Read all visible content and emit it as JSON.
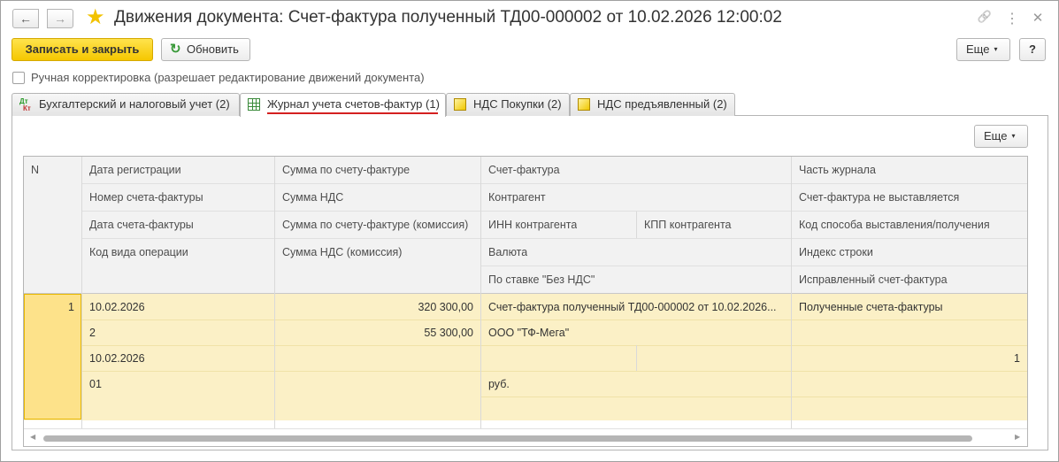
{
  "window": {
    "title": "Движения документа: Счет-фактура полученный ТД00-000002 от 10.02.2026 12:00:02"
  },
  "icons": {
    "back": "←",
    "forward": "→",
    "star": "★",
    "link": "🔗",
    "more": "⋮",
    "close": "✕",
    "refresh": "↻",
    "caret": "▾",
    "sb_left": "◀",
    "sb_right": "▶"
  },
  "toolbar": {
    "save_close_label": "Записать и закрыть",
    "refresh_label": "Обновить",
    "more_label": "Еще",
    "help_label": "?"
  },
  "manual_correction": {
    "label": "Ручная корректировка (разрешает редактирование движений документа)",
    "checked": false
  },
  "tabs": [
    {
      "label": "Бухгалтерский и налоговый учет (2)",
      "icon": "dt-kt-icon",
      "icon_text_top": "Дт",
      "icon_text_bottom": "Кт"
    },
    {
      "label": "Журнал учета счетов-фактур (1)",
      "icon": "register-grid-icon",
      "active": true
    },
    {
      "label": "НДС Покупки (2)",
      "icon": "register-icon"
    },
    {
      "label": "НДС предъявленный (2)",
      "icon": "register-icon"
    }
  ],
  "panel": {
    "more_label": "Еще"
  },
  "table": {
    "headers": {
      "n": "N",
      "c1": [
        "Дата регистрации",
        "Номер счета-фактуры",
        "Дата счета-фактуры",
        "Код вида операции"
      ],
      "c2": [
        "Сумма по счету-фактуре",
        "Сумма НДС",
        "Сумма по счету-фактуре (комиссия)",
        "Сумма НДС (комиссия)"
      ],
      "c3": [
        "Счет-фактура",
        "Контрагент",
        "ИНН контрагента",
        "КПП контрагента",
        "Валюта",
        "По ставке \"Без НДС\""
      ],
      "c4": [
        "Часть журнала",
        "Счет-фактура не выставляется",
        "Код способа выставления/получения",
        "Индекс строки",
        "Исправленный счет-фактура"
      ]
    },
    "rows": [
      {
        "n": "1",
        "c1": [
          "10.02.2026",
          "2",
          "10.02.2026",
          "01"
        ],
        "c2": [
          "320 300,00",
          "55 300,00",
          "",
          ""
        ],
        "c3": [
          "Счет-фактура полученный ТД00-000002 от 10.02.2026...",
          "ООО \"ТФ-Мега\"",
          "",
          "",
          "руб.",
          ""
        ],
        "c4": [
          "Полученные счета-фактуры",
          "",
          "1",
          "",
          ""
        ]
      }
    ]
  }
}
